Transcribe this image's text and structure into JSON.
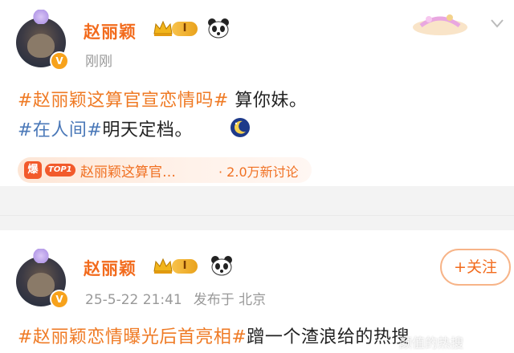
{
  "post1": {
    "username": "赵丽颖",
    "level": "I",
    "time": "刚刚",
    "line1_tag": "#赵丽颖这算官宣恋情吗#",
    "line1_text": " 算你妹。",
    "line2_tag": "#在人间#",
    "line2_text": "明天定档。",
    "hot_icon": "爆",
    "hot_rank": "TOP1",
    "hot_topic": "赵丽颖这算官…",
    "hot_count": "· 2.0万新讨论"
  },
  "post2": {
    "username": "赵丽颖",
    "level": "I",
    "time": "25-5-22 21:41",
    "source": "发布于 北京",
    "follow_label": "+关注",
    "line1_tag": "#赵丽颖恋情曝光后首亮相#",
    "line1_text": "蹭一个渣浪给的热搜"
  },
  "watermark": "颜值的热搜",
  "colors": {
    "accent": "#f26b1d",
    "topic_blue": "#4a78b8",
    "verified": "#f7a21b",
    "hot_red": "#f25a2b"
  },
  "icons": {
    "verified": "verified-badge-icon",
    "vip": "crown-icon",
    "panda": "panda-icon",
    "moon": "moon-icon",
    "more": "chevron-down-icon"
  }
}
